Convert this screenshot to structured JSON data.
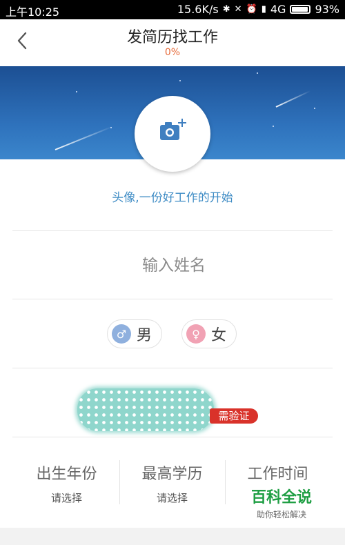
{
  "status_bar": {
    "time": "上午10:25",
    "speed": "15.6K/s",
    "network": "4G",
    "battery": "93%"
  },
  "header": {
    "title": "发简历找工作",
    "progress": "0%"
  },
  "avatar": {
    "caption": "头像,一份好工作的开始"
  },
  "name_field": {
    "placeholder": "输入姓名",
    "value": ""
  },
  "gender": {
    "male_label": "男",
    "female_label": "女",
    "male_symbol": "♂",
    "female_symbol": "♀"
  },
  "phone": {
    "badge": "需验证"
  },
  "fields": [
    {
      "title": "出生年份",
      "value": "请选择"
    },
    {
      "title": "最高学历",
      "value": "请选择"
    },
    {
      "title": "工作时间",
      "value": ""
    }
  ],
  "watermark": {
    "title": "百科全说",
    "subtitle": "助你轻松解决"
  },
  "colors": {
    "accent_blue": "#3f8cc5",
    "progress_orange": "#e76b3a",
    "badge_red": "#d9322a",
    "banner_top": "#1c4f93"
  }
}
